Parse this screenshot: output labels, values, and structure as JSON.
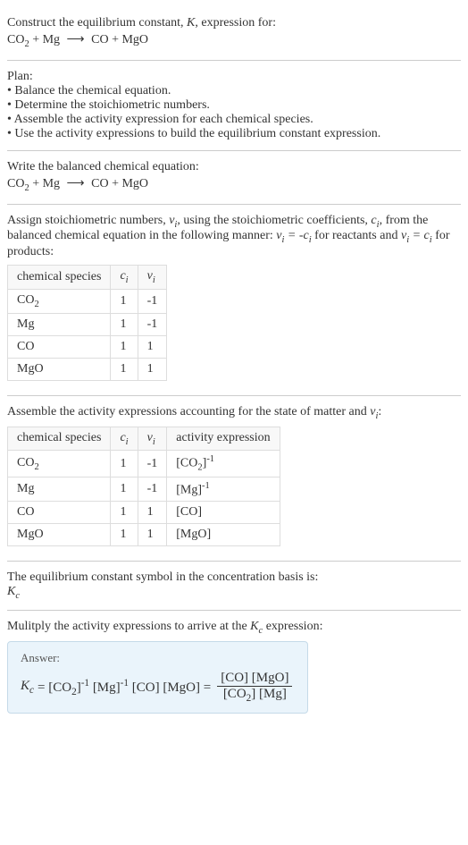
{
  "intro": {
    "line1": "Construct the equilibrium constant, ",
    "K": "K",
    "line1b": ", expression for:",
    "equation": "CO₂ + Mg ⟶ CO + MgO"
  },
  "plan": {
    "title": "Plan:",
    "items": [
      "Balance the chemical equation.",
      "Determine the stoichiometric numbers.",
      "Assemble the activity expression for each chemical species.",
      "Use the activity expressions to build the equilibrium constant expression."
    ]
  },
  "balanced": {
    "title": "Write the balanced chemical equation:",
    "equation": "CO₂ + Mg ⟶ CO + MgO"
  },
  "stoich": {
    "text1": "Assign stoichiometric numbers, ",
    "nu": "ν",
    "sub_i": "i",
    "text2": ", using the stoichiometric coefficients, ",
    "c": "c",
    "text3": ", from the balanced chemical equation in the following manner: ",
    "eq1": "νᵢ = -cᵢ",
    "text4": " for reactants and ",
    "eq2": "νᵢ = cᵢ",
    "text5": " for products:",
    "headers": [
      "chemical species",
      "cᵢ",
      "νᵢ"
    ],
    "rows": [
      {
        "species": "CO₂",
        "c": "1",
        "nu": "-1"
      },
      {
        "species": "Mg",
        "c": "1",
        "nu": "-1"
      },
      {
        "species": "CO",
        "c": "1",
        "nu": "1"
      },
      {
        "species": "MgO",
        "c": "1",
        "nu": "1"
      }
    ]
  },
  "activity": {
    "title": "Assemble the activity expressions accounting for the state of matter and νᵢ:",
    "headers": [
      "chemical species",
      "cᵢ",
      "νᵢ",
      "activity expression"
    ],
    "rows": [
      {
        "species": "CO₂",
        "c": "1",
        "nu": "-1",
        "expr": "[CO₂]⁻¹"
      },
      {
        "species": "Mg",
        "c": "1",
        "nu": "-1",
        "expr": "[Mg]⁻¹"
      },
      {
        "species": "CO",
        "c": "1",
        "nu": "1",
        "expr": "[CO]"
      },
      {
        "species": "MgO",
        "c": "1",
        "nu": "1",
        "expr": "[MgO]"
      }
    ]
  },
  "symbol": {
    "title": "The equilibrium constant symbol in the concentration basis is:",
    "kc": "K",
    "kc_sub": "c"
  },
  "multiply": {
    "title_a": "Mulitply the activity expressions to arrive at the ",
    "kc": "K",
    "kc_sub": "c",
    "title_b": " expression:"
  },
  "answer": {
    "label": "Answer:",
    "lhs_k": "K",
    "lhs_sub": "c",
    "eq": " = ",
    "terms": "[CO₂]⁻¹ [Mg]⁻¹ [CO] [MgO] = ",
    "num": "[CO] [MgO]",
    "den": "[CO₂] [Mg]"
  }
}
